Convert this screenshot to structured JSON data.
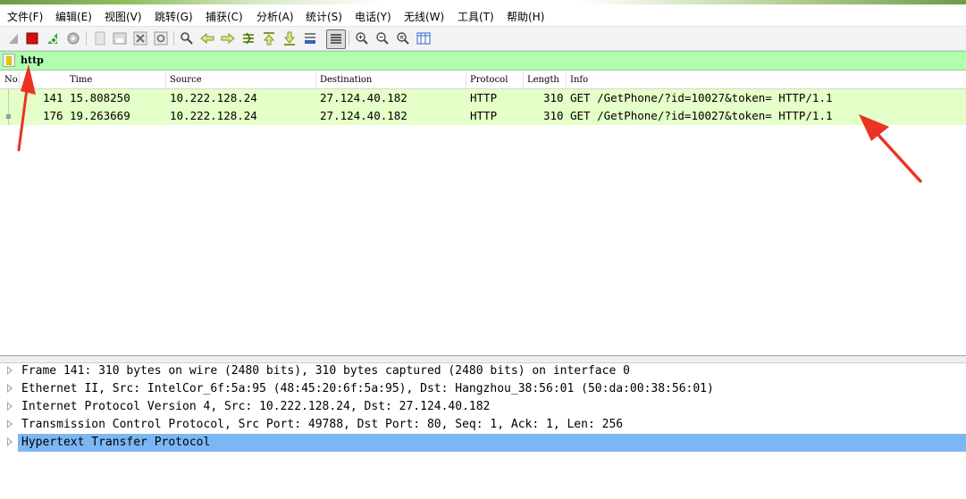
{
  "menu": [
    "文件(F)",
    "编辑(E)",
    "视图(V)",
    "跳转(G)",
    "捕获(C)",
    "分析(A)",
    "统计(S)",
    "电话(Y)",
    "无线(W)",
    "工具(T)",
    "帮助(H)"
  ],
  "toolbar": {
    "icons": [
      "shark-fin-start-icon",
      "stop-capture-icon",
      "restart-capture-icon",
      "capture-options-icon",
      "open-file-icon",
      "save-file-icon",
      "close-file-icon",
      "reload-file-icon",
      "find-packet-icon",
      "go-back-icon",
      "go-forward-icon",
      "go-to-packet-icon",
      "go-first-packet-icon",
      "go-last-packet-icon",
      "autoscroll-icon",
      "colorize-icon",
      "zoom-in-icon",
      "zoom-out-icon",
      "normal-size-icon",
      "resize-columns-icon"
    ]
  },
  "filter": {
    "value": "http"
  },
  "packet_list": {
    "columns": [
      "No.",
      "Time",
      "Source",
      "Destination",
      "Protocol",
      "Length",
      "Info"
    ],
    "rows": [
      {
        "no": "141",
        "time": "15.808250",
        "source": "10.222.128.24",
        "destination": "27.124.40.182",
        "protocol": "HTTP",
        "length": "310",
        "info": "GET /GetPhone/?id=10027&token= HTTP/1.1"
      },
      {
        "no": "176",
        "time": "19.263669",
        "source": "10.222.128.24",
        "destination": "27.124.40.182",
        "protocol": "HTTP",
        "length": "310",
        "info": "GET /GetPhone/?id=10027&token= HTTP/1.1"
      }
    ],
    "row_color": "#e4ffc7"
  },
  "details": {
    "rows": [
      "Frame 141: 310 bytes on wire (2480 bits), 310 bytes captured (2480 bits) on interface 0",
      "Ethernet II, Src: IntelCor_6f:5a:95 (48:45:20:6f:5a:95), Dst: Hangzhou_38:56:01 (50:da:00:38:56:01)",
      "Internet Protocol Version 4, Src: 10.222.128.24, Dst: 27.124.40.182",
      "Transmission Control Protocol, Src Port: 49788, Dst Port: 80, Seq: 1, Ack: 1, Len: 256",
      "Hypertext Transfer Protocol"
    ],
    "selected_color": "#7cb6f3"
  },
  "colors": {
    "filter_bg": "#afffaf",
    "annotation_arrow": "#ea3323"
  }
}
